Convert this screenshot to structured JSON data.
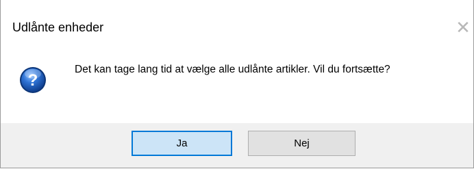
{
  "window": {
    "title": "Udlånte enheder",
    "close_glyph": "✕",
    "close_icon": "close-icon"
  },
  "message": {
    "icon": "question-icon",
    "text": "Det kan tage lang tid at vælge alle udlånte artikler. Vil du fortsætte?"
  },
  "buttons": {
    "yes_label": "Ja",
    "no_label": "Nej"
  },
  "colors": {
    "icon_blue": "#1c5cb8",
    "default_button_border": "#0078d7",
    "default_button_fill": "#cce4f7",
    "footer_bg": "#f0f0f0"
  }
}
